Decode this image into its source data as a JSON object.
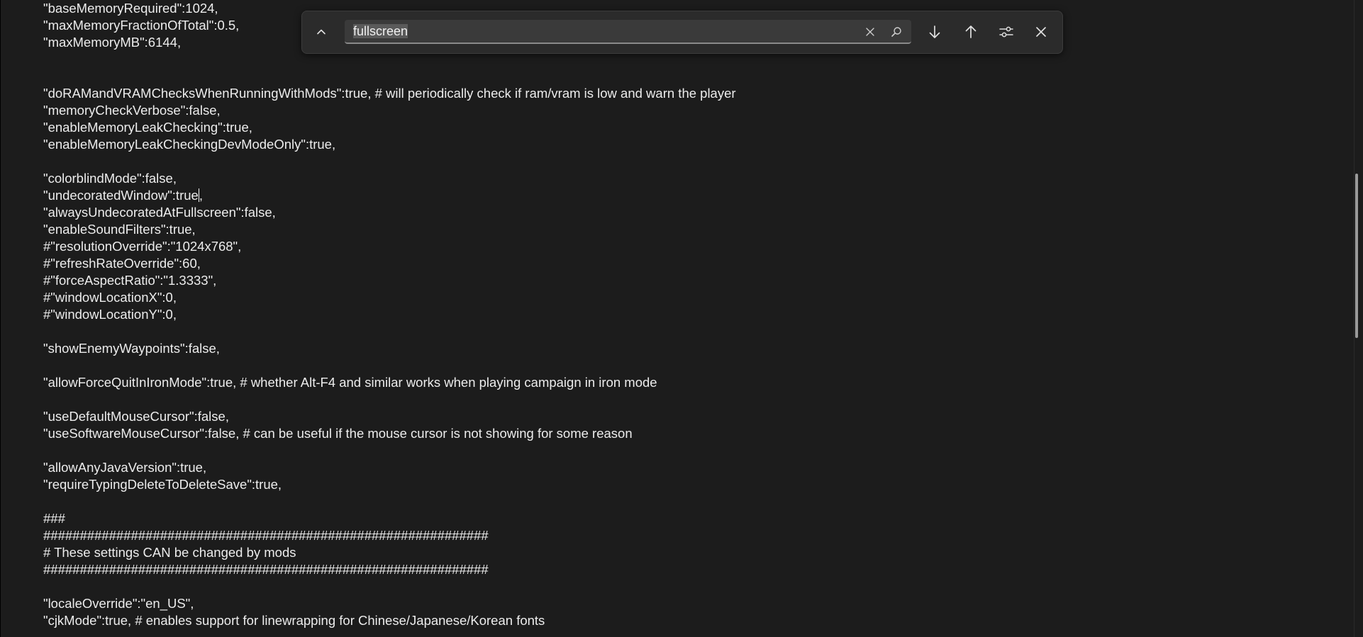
{
  "editor": {
    "lines": [
      "\"baseMemoryRequired\":1024,",
      "\"maxMemoryFractionOfTotal\":0.5,",
      "\"maxMemoryMB\":6144,",
      "",
      "",
      "\"doRAMandVRAMChecksWhenRunningWithMods\":true, # will periodically check if ram/vram is low and warn the player",
      "\"memoryCheckVerbose\":false,",
      "\"enableMemoryLeakChecking\":true,",
      "\"enableMemoryLeakCheckingDevModeOnly\":true,",
      "",
      "\"colorblindMode\":false,",
      "\"undecoratedWindow\":true,",
      "\"alwaysUndecoratedAtFullscreen\":false,",
      "\"enableSoundFilters\":true,",
      "#\"resolutionOverride\":\"1024x768\",",
      "#\"refreshRateOverride\":60,",
      "#\"forceAspectRatio\":\"1.3333\",",
      "#\"windowLocationX\":0,",
      "#\"windowLocationY\":0,",
      "",
      "\"showEnemyWaypoints\":false,",
      "",
      "\"allowForceQuitInIronMode\":true, # whether Alt-F4 and similar works when playing campaign in iron mode",
      "",
      "\"useDefaultMouseCursor\":false,",
      "\"useSoftwareMouseCursor\":false, # can be useful if the mouse cursor is not showing for some reason",
      "",
      "\"allowAnyJavaVersion\":true,",
      "\"requireTypingDeleteToDeleteSave\":true,",
      "",
      "###",
      "#############################################################",
      "# These settings CAN be changed by mods",
      "#############################################################",
      "",
      "\"localeOverride\":\"en_US\",",
      "\"cjkMode\":true, # enables support for linewrapping for Chinese/Japanese/Korean fonts"
    ]
  },
  "find": {
    "query": "fullscreen"
  }
}
